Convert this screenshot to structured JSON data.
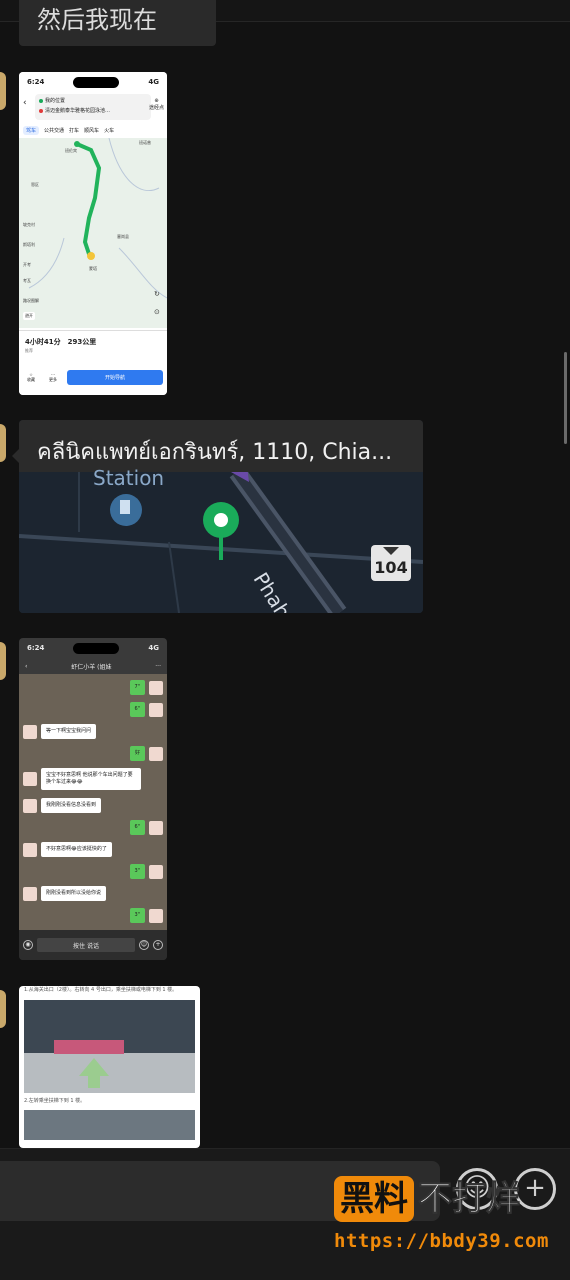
{
  "top_partial_text": "然后我现在提。",
  "map_screenshot": {
    "status_time": "6:24",
    "status_network": "4G",
    "origin": "我的位置",
    "destination": "清迈金鹅泰华雅格花园泳池…",
    "add_waypoint": "途经点",
    "modes": [
      "驾车",
      "公共交通",
      "打车",
      "顺风车",
      "火车"
    ],
    "places": [
      "班伦宾",
      "班诺普",
      "恩区",
      "坡克村",
      "斯塔利",
      "塞岗县",
      "开考",
      "考瓦",
      "蒙塔"
    ],
    "traffic_label": "路况图解",
    "duration_distance": "4小时41分　293公里",
    "route_note": "推荐",
    "fav_label": "收藏",
    "more_label": "更多",
    "start_nav": "开始导航",
    "chip_label": "避开"
  },
  "location_card": {
    "title": "คลีนิคแพทย์เอกรินทร์, 1110, Chia...",
    "station_label": "Station",
    "road_label": "Phaho",
    "route_number": "104"
  },
  "chat_screenshot": {
    "status_time": "6:24",
    "status_network": "4G",
    "chat_title": "虾仁小羊 (姐妹",
    "messages": [
      {
        "side": "out",
        "text": "7\""
      },
      {
        "side": "out",
        "text": "6\""
      },
      {
        "side": "in",
        "text": "等一下啊宝宝我问问"
      },
      {
        "side": "out",
        "text": "好"
      },
      {
        "side": "in",
        "text": "宝宝不好意思啊 他说那个车出问题了要换个车过来😂😂"
      },
      {
        "side": "in",
        "text": "我刚刚没看信息没看到"
      },
      {
        "side": "out",
        "text": "6\""
      },
      {
        "side": "in",
        "text": "不好意思啊😂应该挺快的了"
      },
      {
        "side": "out",
        "text": "3\""
      },
      {
        "side": "in",
        "text": "刚刚没看到所以没给你说"
      },
      {
        "side": "out",
        "text": "3\""
      }
    ],
    "hold_to_talk": "按住 说话"
  },
  "doc_screenshot": {
    "step1": "1.从海关出口（2楼）。右转向 4 号出口，乘坐扶梯或电梯下到 1 楼。",
    "step2": "2.左转乘坐扶梯下到 1 楼。"
  },
  "watermark": {
    "brand_a": "黑料",
    "brand_b": "不打烊",
    "url": "https://bbdy39.com"
  },
  "colors": {
    "background": "#121212",
    "bubble": "#2a2a2a",
    "accent_green": "#1aab5a",
    "watermark_orange": "#f08a0a"
  }
}
